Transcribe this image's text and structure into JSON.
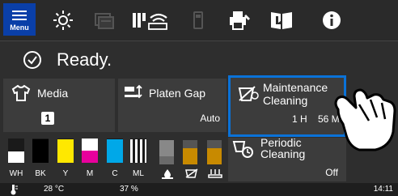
{
  "toolbar": {
    "menu_label": "Menu",
    "icons": [
      "brightness-icon",
      "job-queue-icon",
      "network-status-icon",
      "usb-icon",
      "printer-settings-icon",
      "manual-icon",
      "info-icon"
    ]
  },
  "status": {
    "text": "Ready."
  },
  "media": {
    "title": "Media",
    "slot": "1"
  },
  "platen_gap": {
    "title": "Platen Gap",
    "value": "Auto"
  },
  "maintenance": {
    "title_line1": "Maintenance",
    "title_line2": "Cleaning",
    "hours": "1 H",
    "minutes": "56 M"
  },
  "periodic": {
    "title_line1": "Periodic",
    "title_line2": "Cleaning",
    "value": "Off"
  },
  "inks": [
    {
      "label": "WH",
      "color": "#ffffff",
      "level": 0.45
    },
    {
      "label": "BK",
      "color": "#000000",
      "level": 0.95
    },
    {
      "label": "Y",
      "color": "#ffe800",
      "level": 0.95
    },
    {
      "label": "M",
      "color": "#e8009c",
      "level": 0.45
    },
    {
      "label": "C",
      "color": "#00a8e8",
      "level": 0.95
    },
    {
      "label": "ML",
      "color": "#d8d8d8",
      "level": 0.95
    }
  ],
  "footer": {
    "temperature": "28 °C",
    "humidity": "37 %",
    "time": "14:11"
  },
  "colors": {
    "accent": "#0a72d8",
    "menu_blue": "#0a3fa8",
    "waste_brown": "#c88a00"
  }
}
